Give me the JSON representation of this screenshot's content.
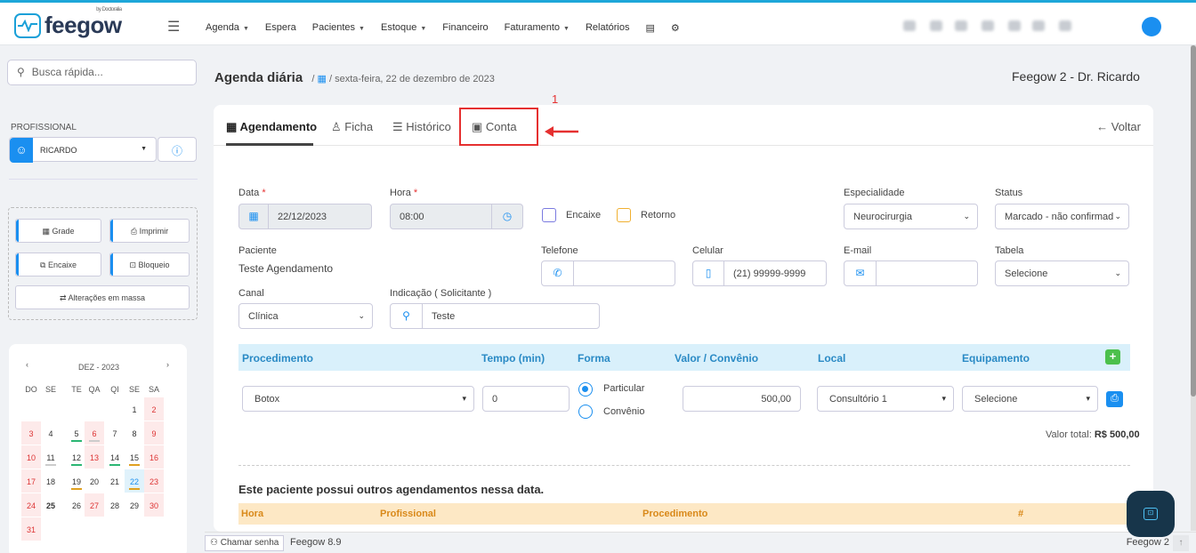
{
  "brand": {
    "name": "feegow",
    "sub": "by Doctoralia"
  },
  "topnav": [
    {
      "label": "Agenda",
      "caret": true
    },
    {
      "label": "Espera",
      "caret": false
    },
    {
      "label": "Pacientes",
      "caret": true
    },
    {
      "label": "Estoque",
      "caret": true
    },
    {
      "label": "Financeiro",
      "caret": false
    },
    {
      "label": "Faturamento",
      "caret": true
    },
    {
      "label": "Relatórios",
      "caret": false
    }
  ],
  "sidebar": {
    "search_placeholder": "Busca rápida...",
    "profissional_label": "PROFISSIONAL",
    "profissional_value": "RICARDO",
    "buttons": {
      "grade": "Grade",
      "imprimir": "Imprimir",
      "encaixe": "Encaixe",
      "bloqueio": "Bloqueio",
      "alteracoes": "Alterações em massa"
    },
    "calendar": {
      "title": "DEZ - 2023",
      "dow": [
        "DO",
        "SE",
        "TE",
        "QA",
        "QI",
        "SE",
        "SA"
      ]
    }
  },
  "header": {
    "title": "Agenda diária",
    "date": "sexta-feira, 22 de dezembro de 2023",
    "doctor": "Feegow 2 - Dr. Ricardo"
  },
  "tabs": [
    {
      "label": "Agendamento",
      "icon": "calendar-icon"
    },
    {
      "label": "Ficha",
      "icon": "user-icon"
    },
    {
      "label": "Histórico",
      "icon": "list-icon"
    },
    {
      "label": "Conta",
      "icon": "money-icon"
    }
  ],
  "voltar": "Voltar",
  "annotation_number": "1",
  "form": {
    "data_label": "Data",
    "data_value": "22/12/2023",
    "hora_label": "Hora",
    "hora_value": "08:00",
    "encaixe": "Encaixe",
    "retorno": "Retorno",
    "especialidade_label": "Especialidade",
    "especialidade_value": "Neurocirurgia",
    "status_label": "Status",
    "status_value": "Marcado - não confirmad",
    "paciente_label": "Paciente",
    "paciente_value": "Teste Agendamento",
    "telefone_label": "Telefone",
    "celular_label": "Celular",
    "celular_value": "(21) 99999-9999",
    "email_label": "E-mail",
    "tabela_label": "Tabela",
    "tabela_value": "Selecione",
    "canal_label": "Canal",
    "canal_value": "Clínica",
    "indicacao_label": "Indicação ( Solicitante )",
    "indicacao_value": "Teste"
  },
  "procedimentos": {
    "headers": [
      "Procedimento",
      "Tempo (min)",
      "Forma",
      "Valor / Convênio",
      "Local",
      "Equipamento"
    ],
    "row": {
      "procedimento": "Botox",
      "tempo": "0",
      "forma_particular": "Particular",
      "forma_convenio": "Convênio",
      "valor": "500,00",
      "local": "Consultório 1",
      "equipamento": "Selecione"
    },
    "total_label": "Valor total:",
    "total_value": "R$ 500,00"
  },
  "outros": {
    "title": "Este paciente possui outros agendamentos nessa data.",
    "headers": [
      "Hora",
      "Profissional",
      "Procedimento",
      "#"
    ]
  },
  "footer": {
    "chamar": "Chamar senha",
    "version": "Feegow 8.9",
    "right": "Feegow 2"
  },
  "colors": {
    "accent": "#1a8ff0",
    "danger": "#e53030",
    "header_bg": "#d9f0fb",
    "warning_bg": "#fde8c5"
  }
}
